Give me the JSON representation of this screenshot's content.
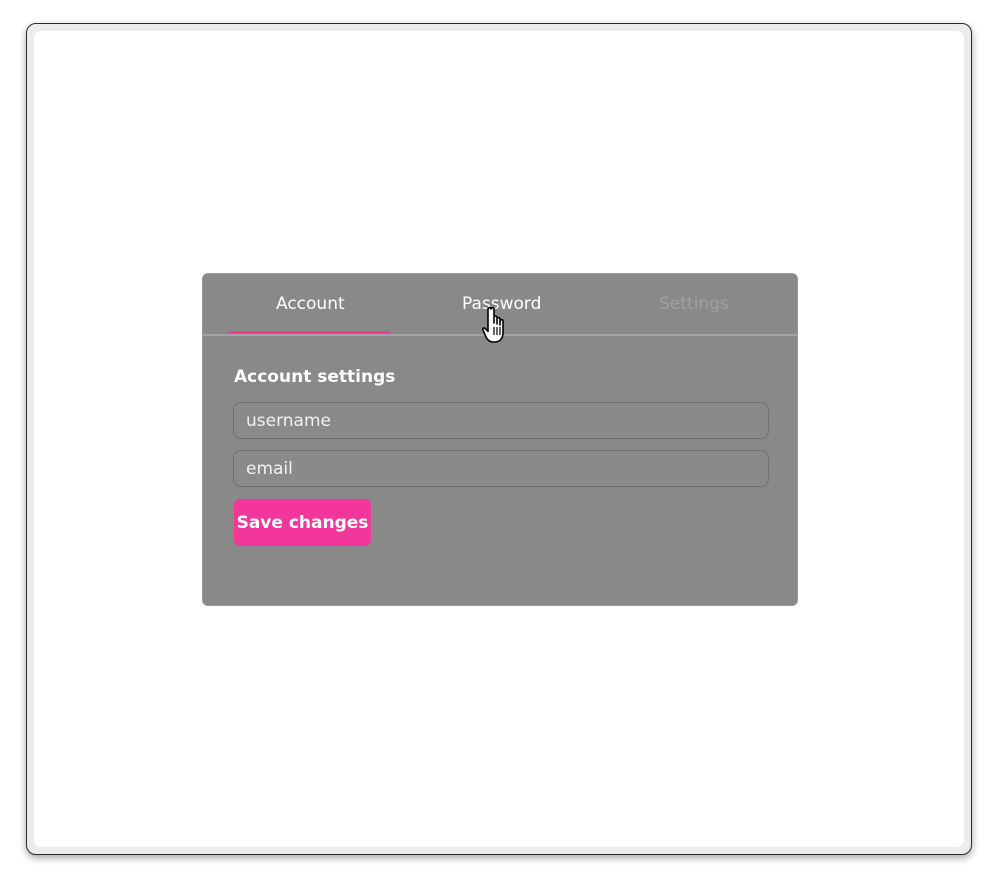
{
  "tabs": [
    {
      "label": "Account",
      "state": "active"
    },
    {
      "label": "Password",
      "state": "hover"
    },
    {
      "label": "Settings",
      "state": "disabled"
    }
  ],
  "section": {
    "title": "Account settings"
  },
  "form": {
    "username_placeholder": "username",
    "email_placeholder": "email",
    "save_label": "Save changes"
  },
  "colors": {
    "accent": "#f2369b",
    "panel_bg": "#898989",
    "disabled_text": "#a0a0a0"
  },
  "cursor": {
    "icon": "hand-pointer-icon"
  }
}
